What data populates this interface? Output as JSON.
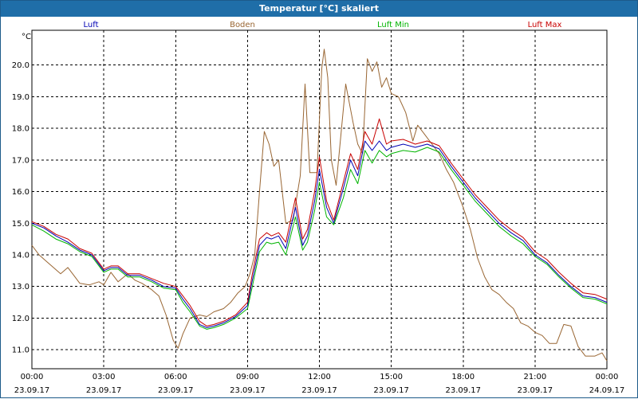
{
  "window": {
    "title": "Temperatur [°C] skaliert"
  },
  "chart_data": {
    "type": "line",
    "title": "Temperatur [°C] skaliert",
    "ylabel": "°C",
    "xlim": [
      0,
      24
    ],
    "ylim": [
      10.4,
      21.1
    ],
    "grid": true,
    "grid_style": "dashed",
    "legend_position": "top",
    "x_ticks": [
      {
        "x": 0,
        "time": "00:00",
        "date": "23.09.17"
      },
      {
        "x": 3,
        "time": "03:00",
        "date": "23.09.17"
      },
      {
        "x": 6,
        "time": "06:00",
        "date": "23.09.17"
      },
      {
        "x": 9,
        "time": "09:00",
        "date": "23.09.17"
      },
      {
        "x": 12,
        "time": "12:00",
        "date": "23.09.17"
      },
      {
        "x": 15,
        "time": "15:00",
        "date": "23.09.17"
      },
      {
        "x": 18,
        "time": "18:00",
        "date": "23.09.17"
      },
      {
        "x": 21,
        "time": "21:00",
        "date": "23.09.17"
      },
      {
        "x": 24,
        "time": "00:00",
        "date": "24.09.17"
      }
    ],
    "y_ticks": [
      "11.0",
      "12.0",
      "13.0",
      "14.0",
      "15.0",
      "16.0",
      "17.0",
      "18.0",
      "19.0",
      "20.0"
    ],
    "x_unit": "hours since 23.09.17 00:00",
    "series": [
      {
        "name": "Luft",
        "color": "#0000b4",
        "points": [
          [
            0,
            15.0
          ],
          [
            0.5,
            14.85
          ],
          [
            1,
            14.6
          ],
          [
            1.5,
            14.4
          ],
          [
            2,
            14.15
          ],
          [
            2.5,
            14.0
          ],
          [
            3,
            13.5
          ],
          [
            3.3,
            13.6
          ],
          [
            3.6,
            13.6
          ],
          [
            4,
            13.35
          ],
          [
            4.5,
            13.35
          ],
          [
            5,
            13.2
          ],
          [
            5.5,
            13.0
          ],
          [
            6,
            12.95
          ],
          [
            6.3,
            12.6
          ],
          [
            6.6,
            12.3
          ],
          [
            7,
            11.8
          ],
          [
            7.3,
            11.7
          ],
          [
            7.6,
            11.75
          ],
          [
            8,
            11.85
          ],
          [
            8.5,
            12.05
          ],
          [
            9,
            12.4
          ],
          [
            9.2,
            13.2
          ],
          [
            9.5,
            14.3
          ],
          [
            9.8,
            14.55
          ],
          [
            10,
            14.5
          ],
          [
            10.3,
            14.6
          ],
          [
            10.6,
            14.2
          ],
          [
            11,
            15.5
          ],
          [
            11.3,
            14.3
          ],
          [
            11.5,
            14.6
          ],
          [
            11.8,
            15.7
          ],
          [
            12,
            16.7
          ],
          [
            12.3,
            15.5
          ],
          [
            12.6,
            15.0
          ],
          [
            13,
            16.1
          ],
          [
            13.3,
            17.0
          ],
          [
            13.6,
            16.5
          ],
          [
            13.9,
            17.6
          ],
          [
            14.2,
            17.3
          ],
          [
            14.5,
            17.6
          ],
          [
            14.8,
            17.3
          ],
          [
            15,
            17.4
          ],
          [
            15.5,
            17.5
          ],
          [
            16,
            17.4
          ],
          [
            16.5,
            17.5
          ],
          [
            17,
            17.35
          ],
          [
            17.5,
            16.8
          ],
          [
            18,
            16.3
          ],
          [
            18.5,
            15.8
          ],
          [
            19,
            15.4
          ],
          [
            19.5,
            15.0
          ],
          [
            20,
            14.7
          ],
          [
            20.5,
            14.45
          ],
          [
            21,
            14.0
          ],
          [
            21.5,
            13.75
          ],
          [
            22,
            13.35
          ],
          [
            22.5,
            13.0
          ],
          [
            23,
            12.7
          ],
          [
            23.5,
            12.65
          ],
          [
            24,
            12.5
          ]
        ]
      },
      {
        "name": "Boden",
        "color": "#996633",
        "points": [
          [
            0,
            14.3
          ],
          [
            0.3,
            14.0
          ],
          [
            0.6,
            13.8
          ],
          [
            0.9,
            13.6
          ],
          [
            1.2,
            13.4
          ],
          [
            1.5,
            13.6
          ],
          [
            1.8,
            13.3
          ],
          [
            2,
            13.1
          ],
          [
            2.4,
            13.05
          ],
          [
            2.8,
            13.15
          ],
          [
            3,
            13.05
          ],
          [
            3.3,
            13.45
          ],
          [
            3.6,
            13.15
          ],
          [
            4,
            13.4
          ],
          [
            4.3,
            13.2
          ],
          [
            4.6,
            13.1
          ],
          [
            5,
            12.9
          ],
          [
            5.3,
            12.7
          ],
          [
            5.6,
            12.1
          ],
          [
            5.9,
            11.3
          ],
          [
            6.1,
            11.05
          ],
          [
            6.3,
            11.5
          ],
          [
            6.6,
            12.0
          ],
          [
            7,
            12.1
          ],
          [
            7.3,
            12.05
          ],
          [
            7.6,
            12.2
          ],
          [
            8,
            12.3
          ],
          [
            8.3,
            12.5
          ],
          [
            8.6,
            12.8
          ],
          [
            8.9,
            13.0
          ],
          [
            9.1,
            13.4
          ],
          [
            9.3,
            14.0
          ],
          [
            9.5,
            16.0
          ],
          [
            9.7,
            17.9
          ],
          [
            9.9,
            17.5
          ],
          [
            10.1,
            16.8
          ],
          [
            10.3,
            17.0
          ],
          [
            10.6,
            15.0
          ],
          [
            10.9,
            15.1
          ],
          [
            11.2,
            16.5
          ],
          [
            11.4,
            19.4
          ],
          [
            11.6,
            16.6
          ],
          [
            11.9,
            16.6
          ],
          [
            12.1,
            19.9
          ],
          [
            12.2,
            20.5
          ],
          [
            12.35,
            19.6
          ],
          [
            12.5,
            17.0
          ],
          [
            12.7,
            16.2
          ],
          [
            12.9,
            17.8
          ],
          [
            13.1,
            19.4
          ],
          [
            13.4,
            18.2
          ],
          [
            13.6,
            17.5
          ],
          [
            13.8,
            17.2
          ],
          [
            14,
            20.2
          ],
          [
            14.2,
            19.8
          ],
          [
            14.4,
            20.1
          ],
          [
            14.6,
            19.3
          ],
          [
            14.8,
            19.6
          ],
          [
            15,
            19.1
          ],
          [
            15.3,
            19.0
          ],
          [
            15.6,
            18.5
          ],
          [
            15.9,
            17.6
          ],
          [
            16.1,
            18.1
          ],
          [
            16.4,
            17.8
          ],
          [
            16.7,
            17.5
          ],
          [
            17,
            17.2
          ],
          [
            17.3,
            16.7
          ],
          [
            17.6,
            16.3
          ],
          [
            18,
            15.5
          ],
          [
            18.3,
            14.8
          ],
          [
            18.6,
            13.9
          ],
          [
            18.9,
            13.3
          ],
          [
            19.2,
            12.9
          ],
          [
            19.5,
            12.75
          ],
          [
            19.8,
            12.5
          ],
          [
            20.1,
            12.3
          ],
          [
            20.4,
            11.85
          ],
          [
            20.7,
            11.75
          ],
          [
            21,
            11.55
          ],
          [
            21.3,
            11.45
          ],
          [
            21.6,
            11.2
          ],
          [
            21.9,
            11.2
          ],
          [
            22.2,
            11.8
          ],
          [
            22.5,
            11.75
          ],
          [
            22.8,
            11.1
          ],
          [
            23.1,
            10.8
          ],
          [
            23.5,
            10.8
          ],
          [
            23.8,
            10.9
          ],
          [
            24,
            10.65
          ]
        ]
      },
      {
        "name": "Luft Min",
        "color": "#00b400",
        "points": [
          [
            0,
            14.95
          ],
          [
            0.5,
            14.75
          ],
          [
            1,
            14.5
          ],
          [
            1.5,
            14.35
          ],
          [
            2,
            14.1
          ],
          [
            2.5,
            13.95
          ],
          [
            3,
            13.45
          ],
          [
            3.3,
            13.55
          ],
          [
            3.6,
            13.55
          ],
          [
            4,
            13.3
          ],
          [
            4.5,
            13.3
          ],
          [
            5,
            13.15
          ],
          [
            5.5,
            12.95
          ],
          [
            6,
            12.9
          ],
          [
            6.3,
            12.5
          ],
          [
            6.6,
            12.2
          ],
          [
            7,
            11.75
          ],
          [
            7.3,
            11.65
          ],
          [
            7.6,
            11.7
          ],
          [
            8,
            11.8
          ],
          [
            8.5,
            12.0
          ],
          [
            9,
            12.3
          ],
          [
            9.2,
            13.0
          ],
          [
            9.5,
            14.1
          ],
          [
            9.8,
            14.4
          ],
          [
            10,
            14.35
          ],
          [
            10.3,
            14.4
          ],
          [
            10.6,
            14.0
          ],
          [
            11,
            15.2
          ],
          [
            11.3,
            14.15
          ],
          [
            11.5,
            14.4
          ],
          [
            11.8,
            15.4
          ],
          [
            12,
            16.3
          ],
          [
            12.3,
            15.2
          ],
          [
            12.6,
            14.95
          ],
          [
            13,
            15.8
          ],
          [
            13.3,
            16.7
          ],
          [
            13.6,
            16.25
          ],
          [
            13.9,
            17.3
          ],
          [
            14.2,
            16.9
          ],
          [
            14.5,
            17.3
          ],
          [
            14.8,
            17.1
          ],
          [
            15,
            17.2
          ],
          [
            15.5,
            17.3
          ],
          [
            16,
            17.25
          ],
          [
            16.5,
            17.4
          ],
          [
            17,
            17.25
          ],
          [
            17.5,
            16.7
          ],
          [
            18,
            16.2
          ],
          [
            18.5,
            15.7
          ],
          [
            19,
            15.3
          ],
          [
            19.5,
            14.9
          ],
          [
            20,
            14.6
          ],
          [
            20.5,
            14.35
          ],
          [
            21,
            13.95
          ],
          [
            21.5,
            13.7
          ],
          [
            22,
            13.3
          ],
          [
            22.5,
            12.95
          ],
          [
            23,
            12.65
          ],
          [
            23.5,
            12.6
          ],
          [
            24,
            12.45
          ]
        ]
      },
      {
        "name": "Luft Max",
        "color": "#c80000",
        "points": [
          [
            0,
            15.05
          ],
          [
            0.5,
            14.9
          ],
          [
            1,
            14.65
          ],
          [
            1.5,
            14.5
          ],
          [
            2,
            14.2
          ],
          [
            2.5,
            14.05
          ],
          [
            3,
            13.55
          ],
          [
            3.3,
            13.65
          ],
          [
            3.6,
            13.65
          ],
          [
            4,
            13.4
          ],
          [
            4.5,
            13.4
          ],
          [
            5,
            13.25
          ],
          [
            5.5,
            13.1
          ],
          [
            6,
            13.0
          ],
          [
            6.3,
            12.7
          ],
          [
            6.6,
            12.4
          ],
          [
            7,
            11.9
          ],
          [
            7.3,
            11.75
          ],
          [
            7.6,
            11.8
          ],
          [
            8,
            11.9
          ],
          [
            8.5,
            12.1
          ],
          [
            9,
            12.5
          ],
          [
            9.2,
            13.4
          ],
          [
            9.5,
            14.5
          ],
          [
            9.8,
            14.7
          ],
          [
            10,
            14.6
          ],
          [
            10.3,
            14.7
          ],
          [
            10.6,
            14.4
          ],
          [
            11,
            15.8
          ],
          [
            11.3,
            14.5
          ],
          [
            11.5,
            14.8
          ],
          [
            11.8,
            16.0
          ],
          [
            12,
            17.1
          ],
          [
            12.3,
            15.7
          ],
          [
            12.6,
            15.1
          ],
          [
            13,
            16.3
          ],
          [
            13.3,
            17.2
          ],
          [
            13.6,
            16.7
          ],
          [
            13.9,
            17.9
          ],
          [
            14.2,
            17.5
          ],
          [
            14.5,
            18.3
          ],
          [
            14.8,
            17.5
          ],
          [
            15,
            17.6
          ],
          [
            15.5,
            17.65
          ],
          [
            16,
            17.5
          ],
          [
            16.5,
            17.6
          ],
          [
            17,
            17.45
          ],
          [
            17.5,
            16.9
          ],
          [
            18,
            16.4
          ],
          [
            18.5,
            15.9
          ],
          [
            19,
            15.5
          ],
          [
            19.5,
            15.1
          ],
          [
            20,
            14.8
          ],
          [
            20.5,
            14.55
          ],
          [
            21,
            14.1
          ],
          [
            21.5,
            13.85
          ],
          [
            22,
            13.45
          ],
          [
            22.5,
            13.1
          ],
          [
            23,
            12.8
          ],
          [
            23.5,
            12.75
          ],
          [
            24,
            12.6
          ]
        ]
      }
    ]
  }
}
